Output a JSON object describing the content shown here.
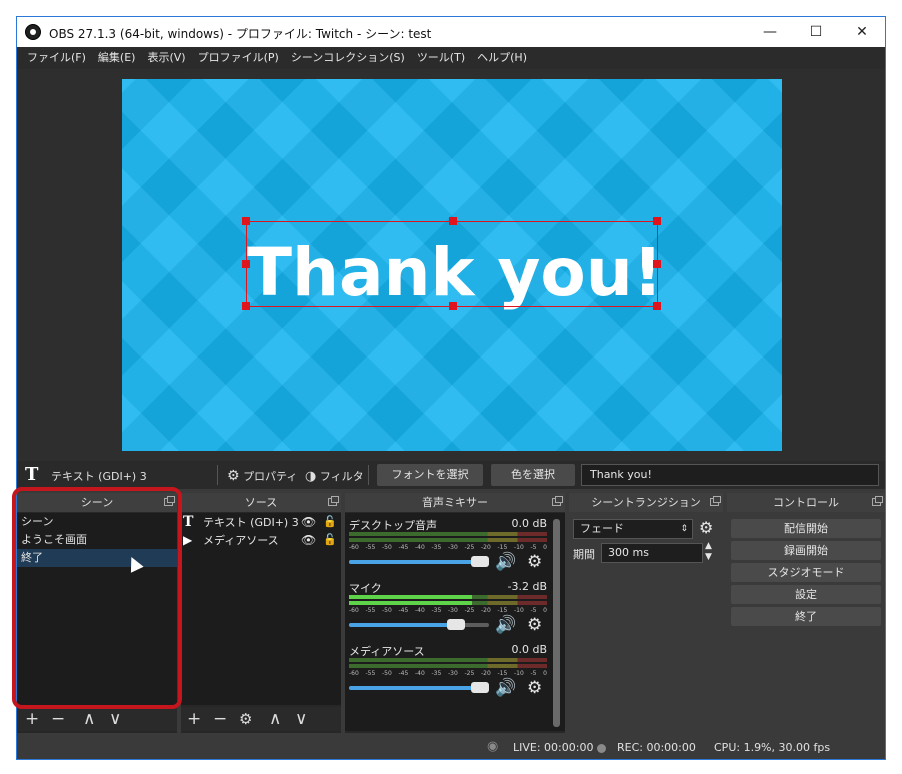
{
  "window": {
    "title": "OBS 27.1.3 (64-bit, windows) - プロファイル: Twitch - シーン: test",
    "buttons": {
      "minimize": "—",
      "maximize": "☐",
      "close": "✕"
    }
  },
  "menu": [
    "ファイル(F)",
    "編集(E)",
    "表示(V)",
    "プロファイル(P)",
    "シーンコレクション(S)",
    "ツール(T)",
    "ヘルプ(H)"
  ],
  "preview": {
    "text": "Thank you!",
    "background_color": "#17b4ee",
    "selection_color": "#e0141c"
  },
  "source_toolbar": {
    "source_icon": "T",
    "source_name": "テキスト (GDI+) 3",
    "properties_label": "プロパティ",
    "filters_label": "フィルタ",
    "font_button": "フォントを選択",
    "color_button": "色を選択",
    "text_value": "Thank you!"
  },
  "scenes": {
    "title": "シーン",
    "items": [
      "シーン",
      "ようこそ画面",
      "終了"
    ],
    "selected_index": 2,
    "footer": {
      "add": "+",
      "remove": "−",
      "up": "∧",
      "down": "∨"
    }
  },
  "sources": {
    "title": "ソース",
    "items": [
      {
        "icon": "T",
        "name": "テキスト (GDI+) 3"
      },
      {
        "icon": "▶",
        "name": "メディアソース"
      }
    ],
    "footer": {
      "add": "+",
      "remove": "−",
      "settings": "⚙",
      "up": "∧",
      "down": "∨"
    }
  },
  "mixer": {
    "title": "音声ミキサー",
    "ticks": [
      "-60",
      "-55",
      "-50",
      "-45",
      "-40",
      "-35",
      "-30",
      "-25",
      "-20",
      "-15",
      "-10",
      "-5",
      "0"
    ],
    "channels": [
      {
        "name": "デスクトップ音声",
        "db": "0.0 dB",
        "level": 0.0,
        "volume": 1.0
      },
      {
        "name": "マイク",
        "db": "-3.2 dB",
        "level": 0.62,
        "volume": 0.8
      },
      {
        "name": "メディアソース",
        "db": "0.0 dB",
        "level": 0.0,
        "volume": 1.0
      }
    ]
  },
  "transitions": {
    "title": "シーントランジション",
    "selected": "フェード",
    "duration_label": "期間",
    "duration_value": "300 ms"
  },
  "controls": {
    "title": "コントロール",
    "buttons": [
      "配信開始",
      "録画開始",
      "スタジオモード",
      "設定",
      "終了"
    ]
  },
  "status": {
    "live": "LIVE: 00:00:00",
    "rec": "REC: 00:00:00",
    "cpu": "CPU: 1.9%, 30.00 fps"
  }
}
